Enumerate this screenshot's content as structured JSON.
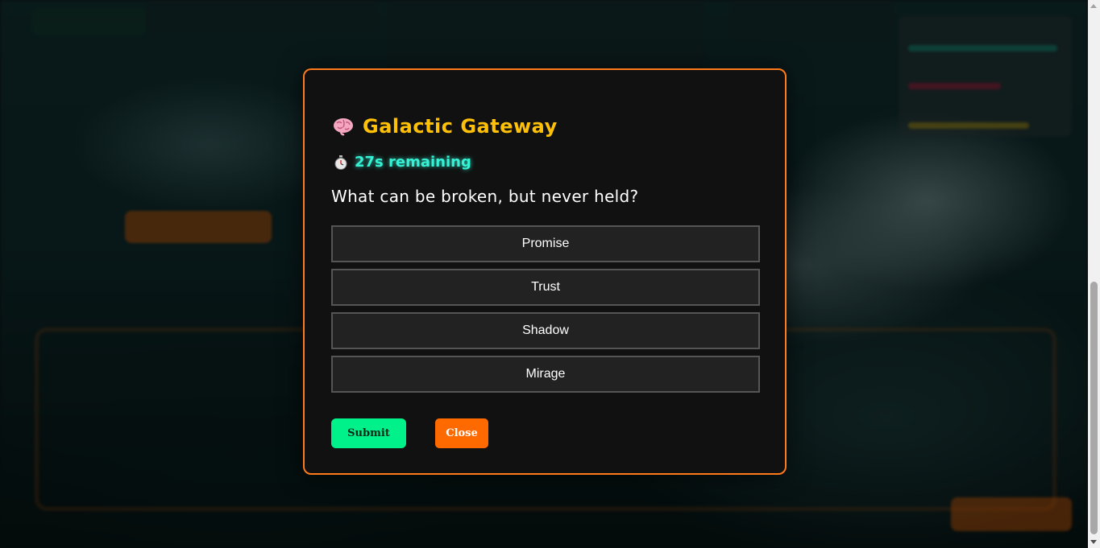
{
  "modal": {
    "title_icon": "brain-icon",
    "title": "Galactic Gateway",
    "timer_icon": "stopwatch-icon",
    "timer_text": "27s remaining",
    "question": "What can be broken, but never held?",
    "options": [
      "Promise",
      "Trust",
      "Shadow",
      "Mirage"
    ],
    "submit_label": "Submit",
    "close_label": "Close",
    "colors": {
      "border": "#ff7a1a",
      "title": "#ffc107",
      "timer": "#35f2d5",
      "submit": "#00f08a",
      "close": "#ff6a00"
    }
  }
}
